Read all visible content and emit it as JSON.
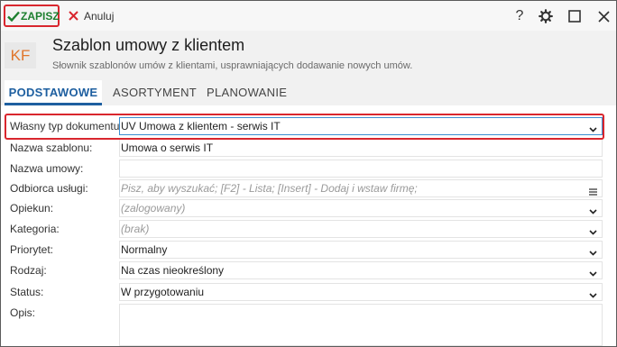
{
  "toolbar": {
    "save_label": "ZAPISZ",
    "cancel_label": "Anuluj",
    "help_label": "?"
  },
  "header": {
    "badge": "KF",
    "title": "Szablon umowy z klientem",
    "subtitle": "Słownik szablonów umów z klientami, usprawniających dodawanie nowych umów."
  },
  "tabs": [
    {
      "label": "PODSTAWOWE",
      "active": true
    },
    {
      "label": "ASORTYMENT",
      "active": false
    },
    {
      "label": "PLANOWANIE",
      "active": false
    }
  ],
  "form": {
    "doc_type": {
      "label": "Własny typ dokumentu:",
      "value": "UV  Umowa z klientem - serwis IT"
    },
    "template_name": {
      "label": "Nazwa szablonu:",
      "value": "Umowa o serwis IT"
    },
    "contract_name": {
      "label": "Nazwa umowy:",
      "value": ""
    },
    "recipient": {
      "label": "Odbiorca usługi:",
      "placeholder": "Pisz, aby wyszukać; [F2] - Lista; [Insert] - Dodaj i wstaw firmę;"
    },
    "guardian": {
      "label": "Opiekun:",
      "placeholder": "(zalogowany)"
    },
    "category": {
      "label": "Kategoria:",
      "placeholder": "(brak)"
    },
    "priority": {
      "label": "Priorytet:",
      "value": "Normalny"
    },
    "kind": {
      "label": "Rodzaj:",
      "value": "Na czas nieokreślony"
    },
    "status": {
      "label": "Status:",
      "value": "W przygotowaniu"
    },
    "description": {
      "label": "Opis:",
      "value": ""
    }
  },
  "colors": {
    "accent": "#1e5fa0",
    "save_green": "#1d7f2f",
    "highlight_red": "#d9262e",
    "badge_orange": "#e0752b"
  }
}
